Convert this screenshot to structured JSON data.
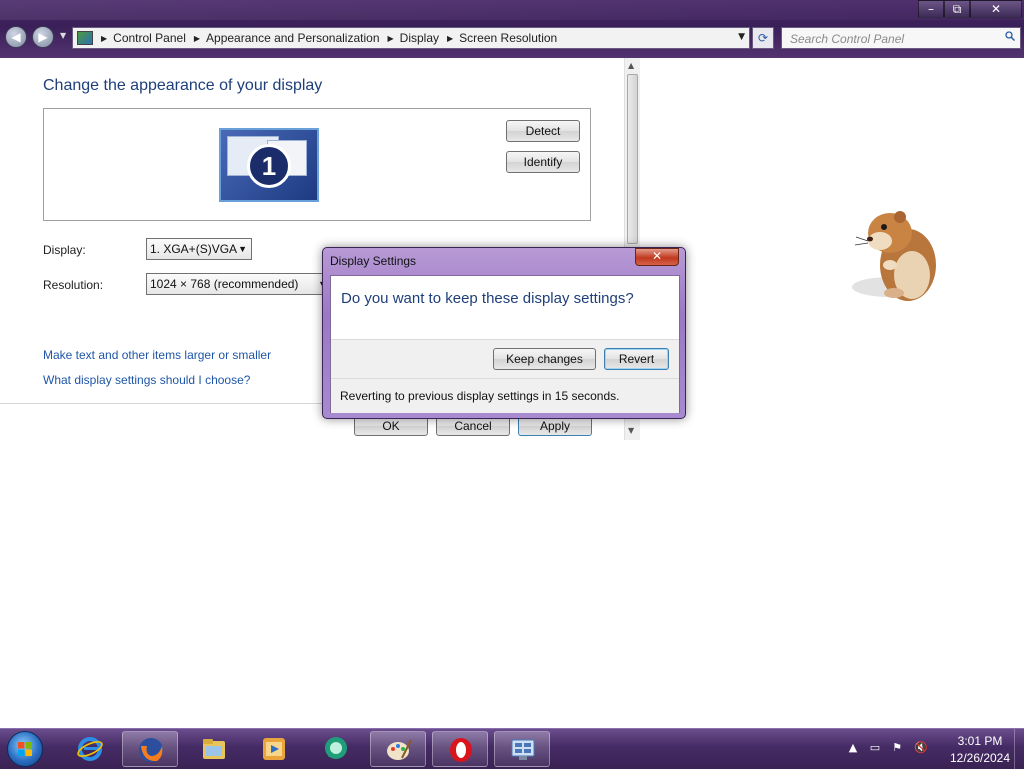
{
  "window": {
    "minimize_label": "–",
    "maximize_label": "⧉",
    "close_label": "✕"
  },
  "address": {
    "breadcrumbs": [
      "Control Panel",
      "Appearance and Personalization",
      "Display",
      "Screen Resolution"
    ],
    "search_placeholder": "Search Control Panel"
  },
  "page": {
    "title": "Change the appearance of your display",
    "monitor_number": "1",
    "detect_label": "Detect",
    "identify_label": "Identify",
    "display_label": "Display:",
    "display_value": "1. XGA+(S)VGA",
    "resolution_label": "Resolution:",
    "resolution_value": "1024 × 768 (recommended)",
    "link_larger": "Make text and other items larger or smaller",
    "link_which": "What display settings should I choose?",
    "ok_label": "OK",
    "cancel_label": "Cancel",
    "apply_label": "Apply"
  },
  "dialog": {
    "title": "Display Settings",
    "close_label": "✕",
    "question": "Do you want to keep these display settings?",
    "keep_label": "Keep changes",
    "revert_label": "Revert",
    "status": "Reverting to previous display settings in 15 seconds."
  },
  "taskbar": {
    "time": "3:01 PM",
    "date": "12/26/2024",
    "apps": [
      "internet-explorer-icon",
      "firefox-icon",
      "file-explorer-icon",
      "media-player-icon",
      "chat-app-icon",
      "paint-icon",
      "opera-icon",
      "control-panel-icon"
    ]
  },
  "colors": {
    "accent": "#1e3f7a",
    "link": "#1f56a8",
    "titlebar": "#4a2b6a",
    "taskbar": "#452b64"
  }
}
